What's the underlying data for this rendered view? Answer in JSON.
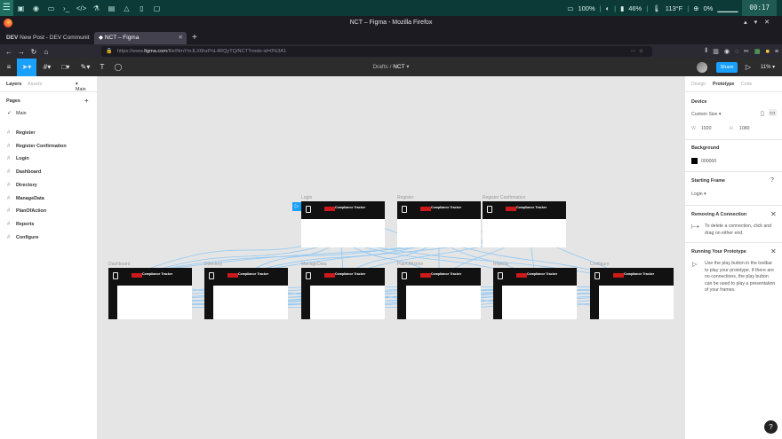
{
  "os": {
    "battery": "100%",
    "volume": "46%",
    "temp": "113°F",
    "network": "0%",
    "clock": "00:17"
  },
  "browser": {
    "window_title": "NCT – Figma - Mozilla Firefox",
    "tabs": [
      {
        "label": "New Post - DEV Communit"
      },
      {
        "label": "NCT – Figma"
      }
    ],
    "url_prefix": "https://www.",
    "url_domain": "figma.com",
    "url_rest": "/file/NmYmJLX6hzPnL4RQyTQ/NCT?node-id=0%3A1"
  },
  "figma": {
    "breadcrumb_folder": "Drafts",
    "breadcrumb_sep": "/",
    "breadcrumb_file": "NCT",
    "share_label": "Share",
    "zoom": "11%"
  },
  "left_panel": {
    "tabs": [
      "Layers",
      "Assets"
    ],
    "page_selector": "Main",
    "pages_label": "Pages",
    "current_page": "Main",
    "layers": [
      "Register",
      "Register Confirmation",
      "Login",
      "Dashboard",
      "Directory",
      "ManageData",
      "PlanOfAction",
      "Reports",
      "Configure"
    ]
  },
  "canvas": {
    "frames_top": [
      {
        "name": "Login"
      },
      {
        "name": "Register"
      },
      {
        "name": "Register Confirmation"
      }
    ],
    "frames_bottom": [
      {
        "name": "Dashboard"
      },
      {
        "name": "Directory"
      },
      {
        "name": "ManageData"
      },
      {
        "name": "PlanOfAction"
      },
      {
        "name": "Reports"
      },
      {
        "name": "Configure"
      }
    ],
    "frame_header_title": "Compliance Tracker"
  },
  "right_panel": {
    "tabs": [
      "Design",
      "Prototype",
      "Code"
    ],
    "device_label": "Device",
    "device_value": "Custom Size",
    "w_label": "W",
    "w_value": "1920",
    "h_label": "H",
    "h_value": "1080",
    "background_label": "Background",
    "background_hex": "000000",
    "starting_frame_label": "Starting Frame",
    "starting_frame_value": "Login",
    "removing_title": "Removing A Connection",
    "removing_text": "To delete a connection, click and drag on either end.",
    "running_title": "Running Your Prototype",
    "running_text": "Use the play button in the toolbar to play your prototype. If there are no connections, the play button can be used to play a presentation of your frames."
  },
  "colors": {
    "accent": "#18a0fb",
    "wire": "#8fc9f5"
  }
}
